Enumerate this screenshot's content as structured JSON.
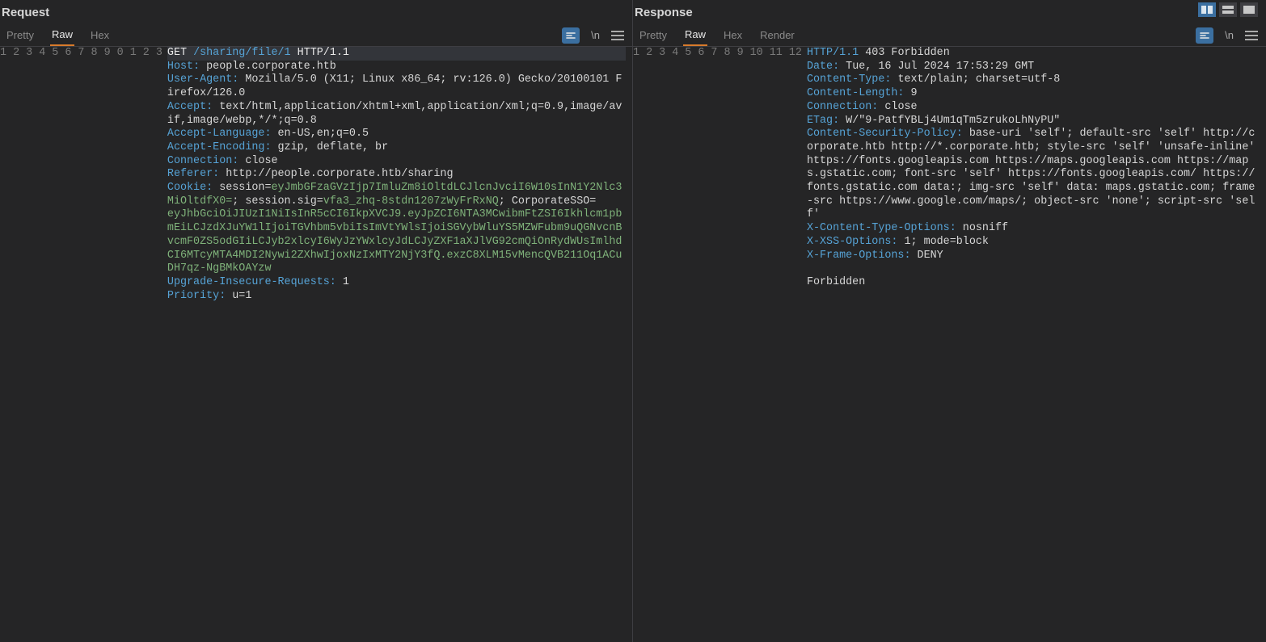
{
  "layoutButtons": {
    "splitActive": true
  },
  "request": {
    "title": "Request",
    "tabs": [
      "Pretty",
      "Raw",
      "Hex"
    ],
    "activeTab": "Raw",
    "actionGlyphBeautify": "≡",
    "actionGlyphNewline": "\\n",
    "lines": [
      {
        "n": "1",
        "t": "reqline",
        "method": "GET",
        "path": "/sharing/file/1",
        "proto": "HTTP/1.1"
      },
      {
        "n": "2",
        "t": "hdr",
        "k": "Host:",
        "v": " people.corporate.htb"
      },
      {
        "n": "3",
        "t": "hdr",
        "k": "User-Agent:",
        "v": " Mozilla/5.0 (X11; Linux x86_64; rv:126.0) Gecko/20100101 Firefox/126.0"
      },
      {
        "n": "4",
        "t": "hdr",
        "k": "Accept:",
        "v": " text/html,application/xhtml+xml,application/xml;q=0.9,image/avif,image/webp,*/*;q=0.8"
      },
      {
        "n": "5",
        "t": "hdr",
        "k": "Accept-Language:",
        "v": " en-US,en;q=0.5"
      },
      {
        "n": "6",
        "t": "hdr",
        "k": "Accept-Encoding:",
        "v": " gzip, deflate, br"
      },
      {
        "n": "7",
        "t": "hdr",
        "k": "Connection:",
        "v": " close"
      },
      {
        "n": "8",
        "t": "hdr",
        "k": "Referer:",
        "v": " http://people.corporate.htb/sharing"
      },
      {
        "n": "9",
        "t": "cookie",
        "k": "Cookie:",
        "parts": [
          {
            "name": " session",
            "val": "eyJmbGFzaGVzIjp7ImluZm8iOltdLCJlcnJvciI6W10sInN1Y2Nlc3MiOltdfX0="
          },
          {
            "name": " session.sig",
            "eqPrefix": "\n",
            "val": "vfa3_zhq-8stdn1207zWyFrRxNQ"
          },
          {
            "name": " CorporateSSO",
            "val": "\neyJhbGciOiJIUzI1NiIsInR5cCI6IkpXVCJ9.eyJpZCI6NTA3MCwibmFtZSI6Ikhlcm1pbmEiLCJzdXJuYW1lIjoiTGVhbm5vbiIsImVtYWlsIjoiSGVybWluYS5MZWFubm9uQGNvcnBvcmF0ZS5odGIiLCJyb2xlcyI6WyJzYWxlcyJdLCJyZXF1aXJlVG92cmQiOnRydWUsImlhdCI6MTcyMTA4MDI2Nywi2ZXhwIjoxNzIxMTY2NjY3fQ.exzC8XLM15vMencQVB211Oq1ACuDH7qz-NgBMkOAYzw"
          }
        ]
      },
      {
        "n": "0",
        "t": "hdr",
        "k": "Upgrade-Insecure-Requests:",
        "v": " 1"
      },
      {
        "n": "1",
        "t": "hdr",
        "k": "Priority:",
        "v": " u=1"
      },
      {
        "n": "2",
        "t": "blank"
      },
      {
        "n": "3",
        "t": "blank"
      }
    ]
  },
  "response": {
    "title": "Response",
    "tabs": [
      "Pretty",
      "Raw",
      "Hex",
      "Render"
    ],
    "activeTab": "Raw",
    "actionGlyphNewline": "\\n",
    "lines": [
      {
        "n": "1",
        "t": "status",
        "proto": "HTTP/1.1",
        "rest": " 403 Forbidden"
      },
      {
        "n": "2",
        "t": "hdr",
        "k": "Date:",
        "v": " Tue, 16 Jul 2024 17:53:29 GMT"
      },
      {
        "n": "3",
        "t": "hdr",
        "k": "Content-Type:",
        "v": " text/plain; charset=utf-8"
      },
      {
        "n": "4",
        "t": "hdr",
        "k": "Content-Length:",
        "v": " 9"
      },
      {
        "n": "5",
        "t": "hdr",
        "k": "Connection:",
        "v": " close"
      },
      {
        "n": "6",
        "t": "hdr",
        "k": "ETag:",
        "v": " W/\"9-PatfYBLj4Um1qTm5zrukoLhNyPU\""
      },
      {
        "n": "7",
        "t": "hdr",
        "k": "Content-Security-Policy:",
        "v": " base-uri 'self'; default-src 'self' http://corporate.htb http://*.corporate.htb; style-src 'self' 'unsafe-inline' https://fonts.googleapis.com https://maps.googleapis.com https://maps.gstatic.com; font-src 'self' https://fonts.googleapis.com/ https://fonts.gstatic.com data:; img-src 'self' data: maps.gstatic.com; frame-src https://www.google.com/maps/; object-src 'none'; script-src 'self'"
      },
      {
        "n": "8",
        "t": "hdr",
        "k": "X-Content-Type-Options:",
        "v": " nosniff"
      },
      {
        "n": "9",
        "t": "hdr",
        "k": "X-XSS-Options:",
        "v": " 1; mode=block"
      },
      {
        "n": "10",
        "t": "hdr",
        "k": "X-Frame-Options:",
        "v": " DENY"
      },
      {
        "n": "11",
        "t": "blank"
      },
      {
        "n": "12",
        "t": "body",
        "v": "Forbidden"
      }
    ]
  }
}
